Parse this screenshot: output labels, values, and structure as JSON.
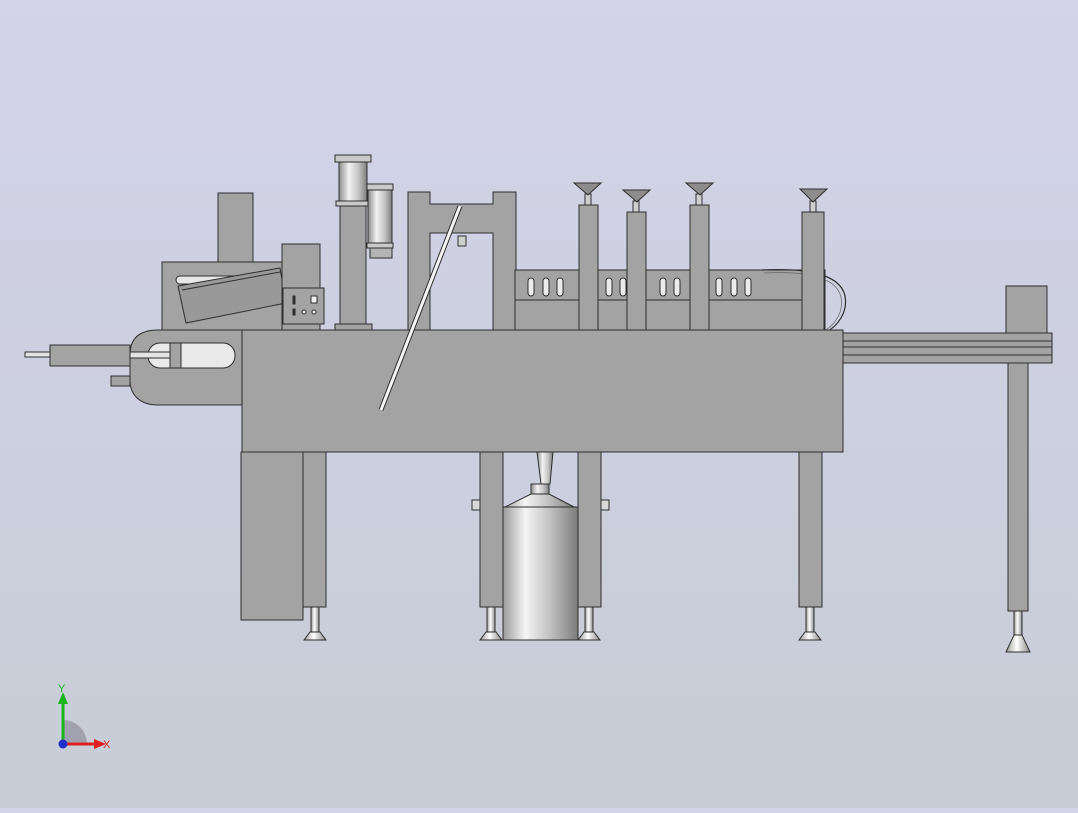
{
  "viewport": {
    "background_top": "#d3d3e9",
    "background_bottom": "#c7cdd6"
  },
  "model": {
    "body_fill": "#a3a3a3",
    "edge_color": "#2e2e2e",
    "metal_light": "#f4f4f4",
    "metal_dark": "#7a7a7a"
  },
  "triad": {
    "y_label": "Y",
    "x_label": "X",
    "y_color": "#1db31d",
    "x_color": "#e02020",
    "z_color": "#2030c8"
  }
}
